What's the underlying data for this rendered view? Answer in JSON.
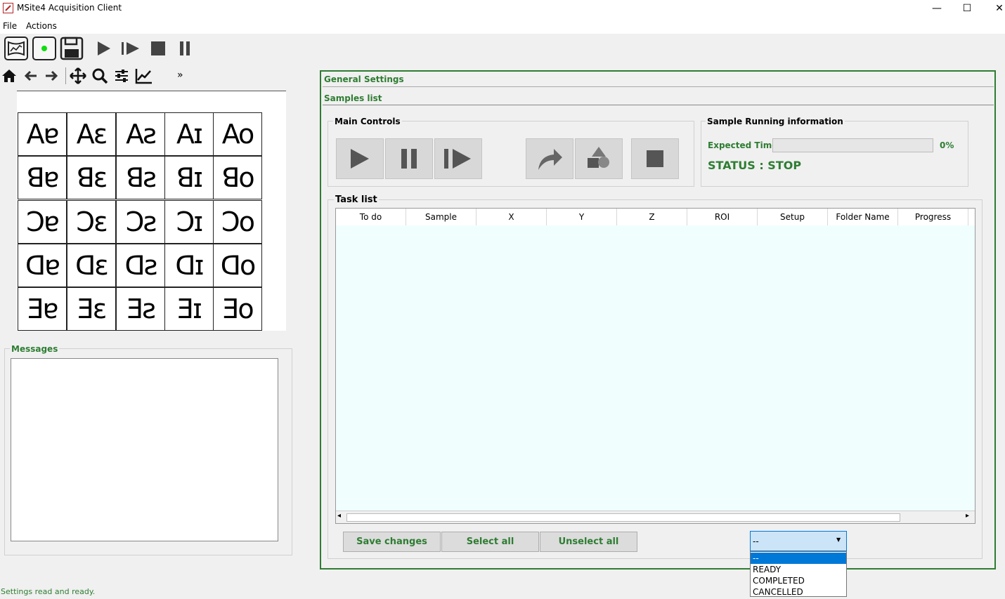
{
  "window": {
    "title": "MSite4 Acquisition Client",
    "minimize": "—",
    "maximize": "☐",
    "close": "✕"
  },
  "menu": {
    "file": "File",
    "actions": "Actions"
  },
  "nav_toolbar": {
    "overflow": "»"
  },
  "grid": {
    "rows": [
      [
        "Aɐ",
        "Aɛ",
        "Aƨ",
        "Aɪ",
        "Ao"
      ],
      [
        "ꓭɐ",
        "ꓭɛ",
        "ꓭƨ",
        "ꓭɪ",
        "ꓭo"
      ],
      [
        "Ↄɐ",
        "Ↄɛ",
        "Ↄƨ",
        "Ↄɪ",
        "Ↄo"
      ],
      [
        "ᗡɐ",
        "ᗡɛ",
        "ᗡƨ",
        "ᗡɪ",
        "ᗡo"
      ],
      [
        "Ǝɐ",
        "Ǝɛ",
        "Ǝƨ",
        "Ǝɪ",
        "Ǝo"
      ]
    ]
  },
  "messages": {
    "label": "Messages"
  },
  "statusbar": {
    "text": "Settings read and ready."
  },
  "panel": {
    "general_settings": "General Settings",
    "samples_list": "Samples list",
    "main_controls": "Main Controls",
    "sample_running_info": "Sample Running information",
    "expected_time_label": "Expected Time:",
    "progress": 0,
    "progress_text": "0%",
    "status": "STATUS : STOP",
    "task_list": "Task list"
  },
  "table": {
    "columns": [
      "To do",
      "Sample",
      "X",
      "Y",
      "Z",
      "ROI",
      "Setup",
      "Folder Name",
      "Progress"
    ],
    "scroll_left": "◂",
    "scroll_right": "▸"
  },
  "buttons": {
    "save_changes": "Save changes",
    "select_all": "Select all",
    "unselect_all": "Unselect all"
  },
  "combo": {
    "value": "--",
    "arrow": "▼",
    "options": [
      "--",
      "READY",
      "COMPLETED",
      "CANCELLED"
    ]
  },
  "colors": {
    "accent_green": "#2e7d32",
    "table_bg": "#f0fffe",
    "selected_option": "#0078d7"
  }
}
